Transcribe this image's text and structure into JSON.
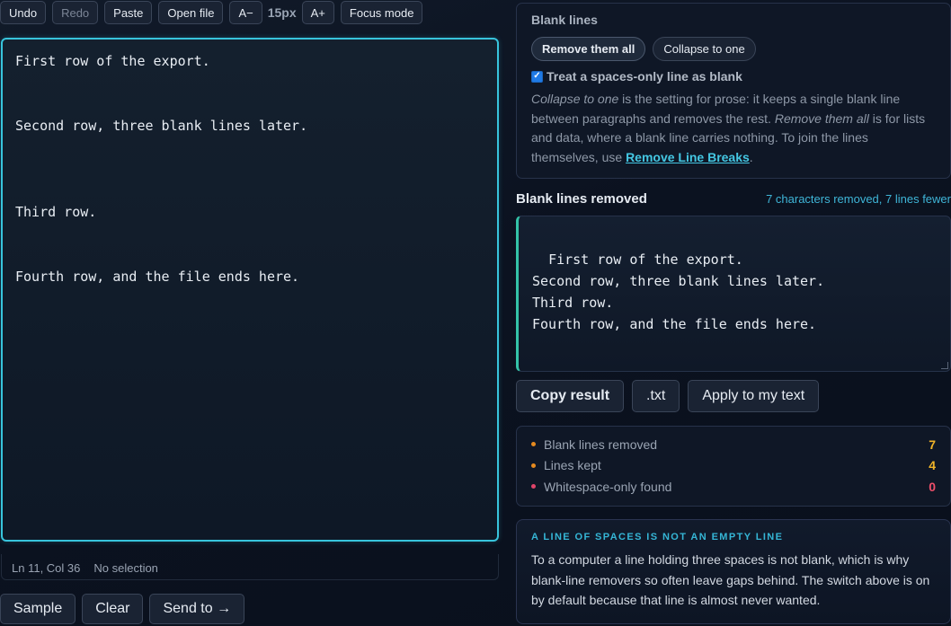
{
  "toolbar": {
    "undo": "Undo",
    "redo": "Redo",
    "paste": "Paste",
    "open_file": "Open file",
    "font_smaller": "A−",
    "font_size": "15px",
    "font_larger": "A+",
    "focus_mode": "Focus mode"
  },
  "editor": {
    "text": "First row of the export.\n\n\nSecond row, three blank lines later.\n\n\n\nThird row.\n\n\nFourth row, and the file ends here."
  },
  "status": {
    "position": "Ln 11, Col 36",
    "selection": "No selection"
  },
  "bottom_actions": {
    "sample": "Sample",
    "clear": "Clear",
    "send_to": "Send to →"
  },
  "options": {
    "title": "Blank lines",
    "mode_remove_all": "Remove them all",
    "mode_collapse": "Collapse to one",
    "selected_mode": "Remove them all",
    "checkbox_label": "Treat a spaces-only line as blank",
    "checkbox_checked": true,
    "desc_em1": "Collapse to one",
    "desc_text1": " is the setting for prose: it keeps a single blank line between paragraphs and removes the rest. ",
    "desc_em2": "Remove them all",
    "desc_text2": " is for lists and data, where a blank line carries nothing. To join the lines themselves, use ",
    "desc_link": "Remove Line Breaks",
    "desc_end": "."
  },
  "result": {
    "title": "Blank lines removed",
    "meta": "7 characters removed, 7 lines fewer",
    "text": "First row of the export.\nSecond row, three blank lines later.\nThird row.\nFourth row, and the file ends here."
  },
  "result_actions": {
    "copy": "Copy result",
    "txt": ".txt",
    "apply": "Apply to my text"
  },
  "stats": {
    "rows": [
      {
        "label": "Blank lines removed",
        "value": "7",
        "color": "#f0b429",
        "dot": "#e58a1f"
      },
      {
        "label": "Lines kept",
        "value": "4",
        "color": "#f0b429",
        "dot": "#e58a1f"
      },
      {
        "label": "Whitespace-only found",
        "value": "0",
        "color": "#ef4f6a",
        "dot": "#e0446a"
      }
    ]
  },
  "note": {
    "title": "A LINE OF SPACES IS NOT AN EMPTY LINE",
    "body": "To a computer a line holding three spaces is not blank, which is why blank-line removers so often leave gaps behind. The switch above is on by default because that line is almost never wanted."
  }
}
